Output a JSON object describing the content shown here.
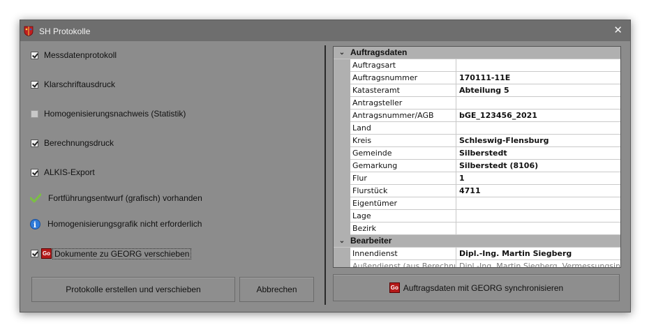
{
  "window": {
    "title": "SH Protokolle",
    "close_glyph": "✕"
  },
  "left_panel": {
    "checkboxes": [
      {
        "label": "Messdatenprotokoll",
        "checked": true
      },
      {
        "label": "Klarschriftausdruck",
        "checked": true
      },
      {
        "label": "Homogenisierungsnachweis (Statistik)",
        "checked": false
      },
      {
        "label": "Berechnungsdruck",
        "checked": true
      },
      {
        "label": "ALKIS-Export",
        "checked": true
      }
    ],
    "status": [
      {
        "icon": "checkmark-icon",
        "text": "Fortführungsentwurf (grafisch) vorhanden"
      },
      {
        "icon": "info-icon",
        "text": "Homogenisierungsgrafik nicht erforderlich"
      }
    ],
    "georg_checkbox": {
      "label": "Dokumente zu GEORG verschieben",
      "checked": true,
      "icon_text": "Go"
    },
    "buttons": {
      "create": "Protokolle erstellen und verschieben",
      "cancel": "Abbrechen"
    }
  },
  "property_grid": {
    "categories": [
      {
        "name": "Auftragsdaten",
        "rows": [
          {
            "key": "Auftragsart",
            "value": ""
          },
          {
            "key": "Auftragsnummer",
            "value": "170111-11E"
          },
          {
            "key": "Katasteramt",
            "value": "Abteilung 5"
          },
          {
            "key": "Antragsteller",
            "value": ""
          },
          {
            "key": "Antragsnummer/AGB",
            "value": "bGE_123456_2021"
          },
          {
            "key": "Land",
            "value": ""
          },
          {
            "key": "Kreis",
            "value": "Schleswig-Flensburg"
          },
          {
            "key": "Gemeinde",
            "value": "Silberstedt"
          },
          {
            "key": "Gemarkung",
            "value": "Silberstedt (8106)"
          },
          {
            "key": "Flur",
            "value": "1"
          },
          {
            "key": "Flurstück",
            "value": "4711"
          },
          {
            "key": "Eigentümer",
            "value": ""
          },
          {
            "key": "Lage",
            "value": ""
          },
          {
            "key": "Bezirk",
            "value": ""
          }
        ]
      },
      {
        "name": "Bearbeiter",
        "rows": [
          {
            "key": "Innendienst",
            "value": "Dipl.-Ing. Martin Siegberg"
          },
          {
            "key": "Außendienst (aus Berechnungen)",
            "value": "Dipl.-Ing. Martin Siegberg, Vermessungsinge",
            "disabled": true
          }
        ]
      }
    ]
  },
  "sync_button": {
    "label": "Auftragsdaten mit GEORG synchronisieren",
    "icon_text": "Go"
  },
  "colors": {
    "window_bg": "#8c8c8c",
    "titlebar": "#6e6e6e",
    "category_bg": "#b0b0b0",
    "georg_red": "#b51a1a",
    "info_blue": "#2f7bd9",
    "check_green": "#7bc043"
  }
}
